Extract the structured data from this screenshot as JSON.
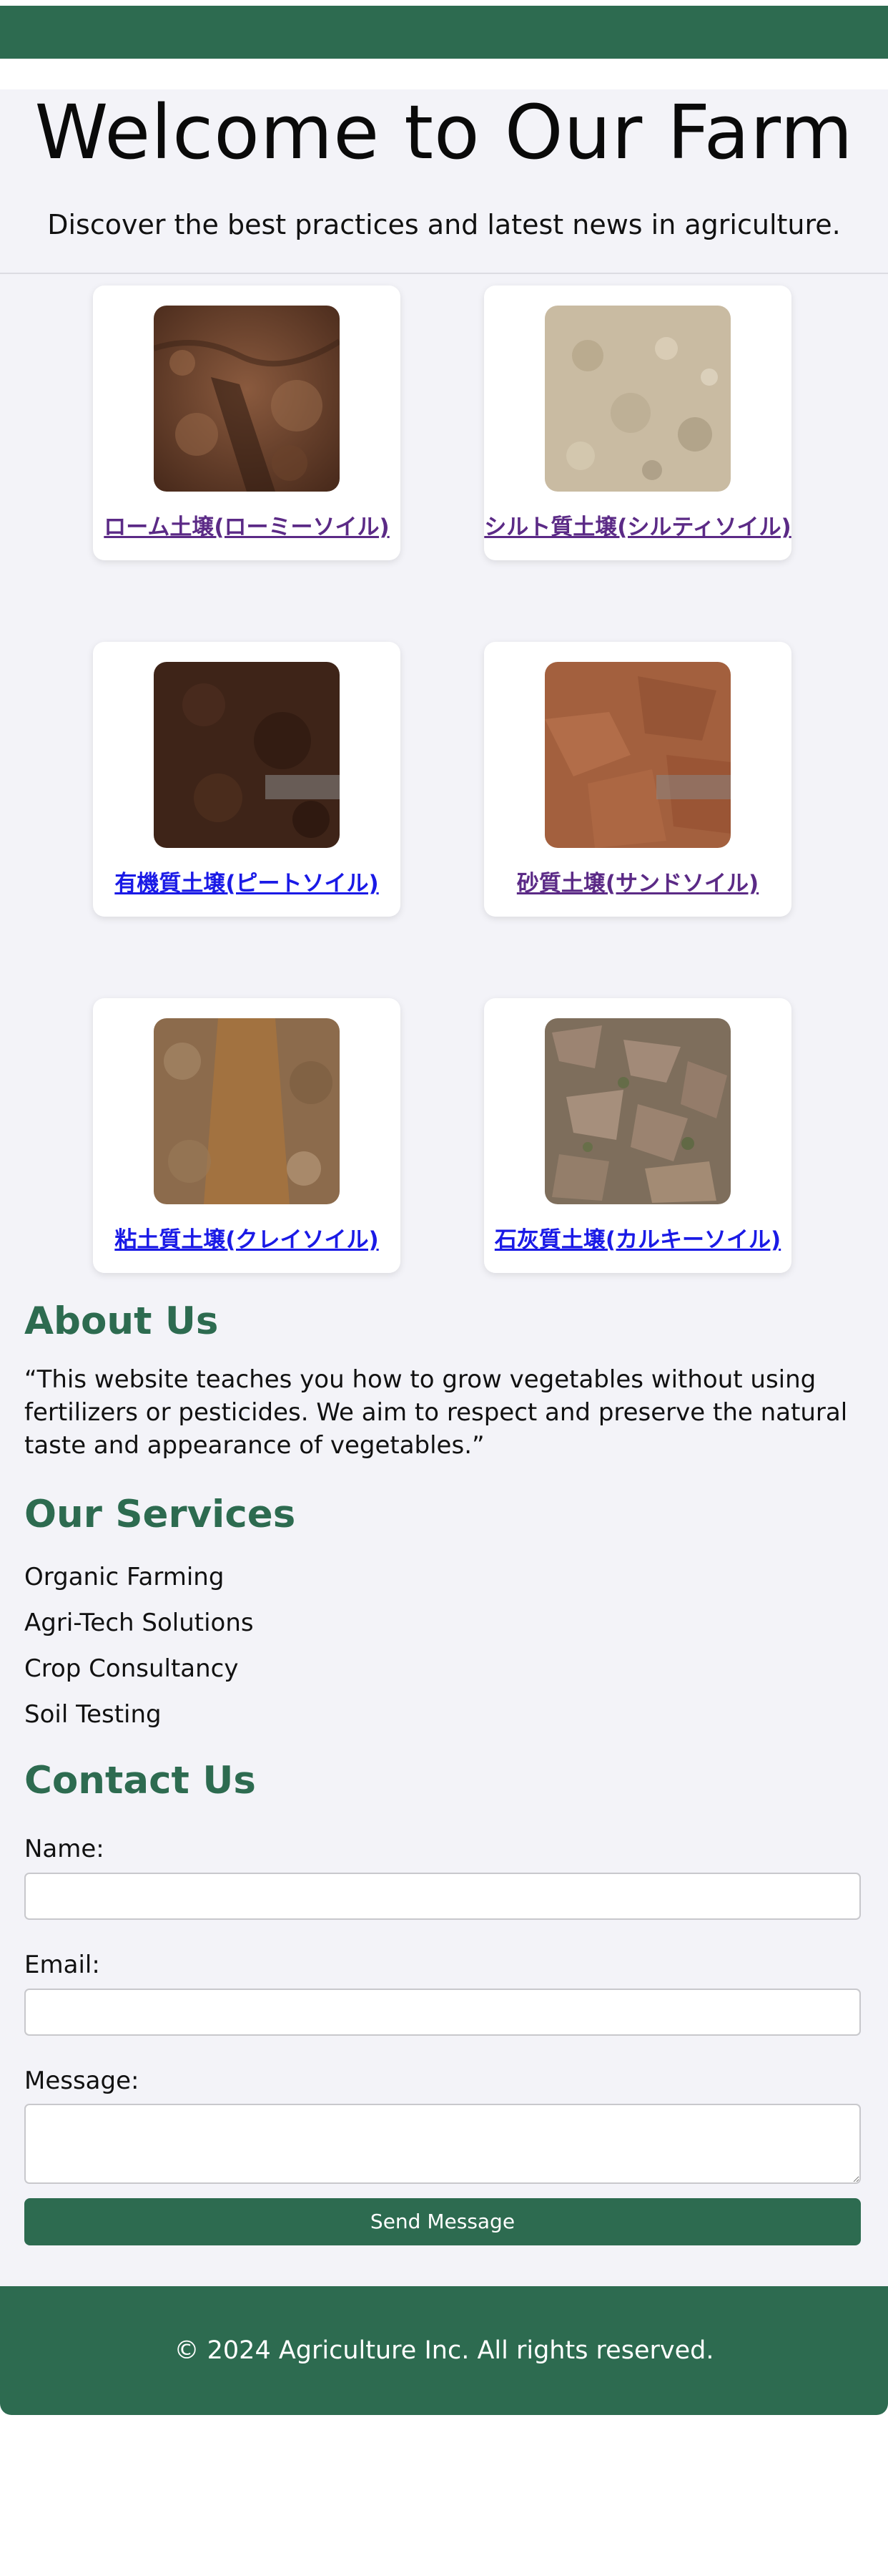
{
  "hero": {
    "title": "Welcome to Our Farm",
    "subtitle": "Discover the best practices and latest news in agriculture."
  },
  "soils": [
    {
      "label": "ローム土壌(ローミーソイル)",
      "visited": true,
      "image": "loamy-soil"
    },
    {
      "label": "シルト質土壌(シルティソイル)",
      "visited": true,
      "image": "silty-soil"
    },
    {
      "label": "有機質土壌(ピートソイル)",
      "visited": false,
      "image": "peat-soil"
    },
    {
      "label": "砂質土壌(サンドソイル)",
      "visited": true,
      "image": "sandy-soil"
    },
    {
      "label": "粘土質土壌(クレイソイル)",
      "visited": false,
      "image": "clay-soil"
    },
    {
      "label": "石灰質土壌(カルキーソイル)",
      "visited": false,
      "image": "chalky-soil"
    }
  ],
  "about": {
    "heading": "About Us",
    "text": "“This website teaches you how to grow vegetables without using fertilizers or pesticides. We aim to respect and preserve the natural taste and appearance of vegetables.”"
  },
  "services": {
    "heading": "Our Services",
    "items": [
      "Organic Farming",
      "Agri-Tech Solutions",
      "Crop Consultancy",
      "Soil Testing"
    ]
  },
  "contact": {
    "heading": "Contact Us",
    "name_label": "Name:",
    "email_label": "Email:",
    "message_label": "Message:",
    "name_value": "",
    "email_value": "",
    "message_value": "",
    "submit_label": "Send Message"
  },
  "footer": {
    "text": "© 2024 Agriculture Inc. All rights reserved."
  },
  "colors": {
    "brand_green": "#2d6b50",
    "page_background": "#f3f3f8",
    "visited_link": "#5b2a86",
    "link": "#1a1ae6"
  }
}
